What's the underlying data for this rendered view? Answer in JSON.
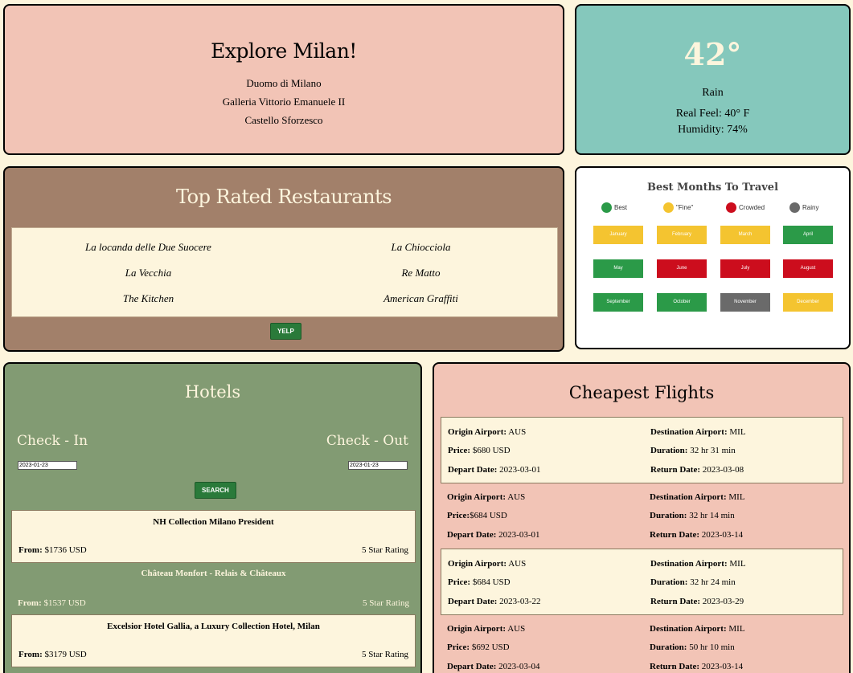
{
  "explore": {
    "title": "Explore Milan!",
    "attractions": [
      "Duomo di Milano",
      "Galleria Vittorio Emanuele II",
      "Castello Sforzesco"
    ]
  },
  "weather": {
    "temperature": "42°",
    "condition": "Rain",
    "real_feel": "Real Feel: 40° F",
    "humidity": "Humidity: 74%"
  },
  "restaurants": {
    "title": "Top Rated Restaurants",
    "items": [
      "La locanda delle Due Suocere",
      "La Chiocciola",
      "La Vecchia",
      "Re Matto",
      "The Kitchen",
      "American Graffiti"
    ],
    "yelp_label": "YELP"
  },
  "months": {
    "title": "Best Months To Travel",
    "legend": [
      {
        "label": "Best",
        "color": "#2b9a48"
      },
      {
        "label": "\"Fine\"",
        "color": "#f4c430"
      },
      {
        "label": "Crowded",
        "color": "#cc0d1d"
      },
      {
        "label": "Rainy",
        "color": "#6a6a6a"
      }
    ],
    "items": [
      {
        "label": "January",
        "color": "#f4c430"
      },
      {
        "label": "February",
        "color": "#f4c430"
      },
      {
        "label": "March",
        "color": "#f4c430"
      },
      {
        "label": "April",
        "color": "#2b9a48"
      },
      {
        "label": "May",
        "color": "#2b9a48"
      },
      {
        "label": "June",
        "color": "#cc0d1d"
      },
      {
        "label": "July",
        "color": "#cc0d1d"
      },
      {
        "label": "August",
        "color": "#cc0d1d"
      },
      {
        "label": "September",
        "color": "#2b9a48"
      },
      {
        "label": "October",
        "color": "#2b9a48"
      },
      {
        "label": "November",
        "color": "#6a6a6a"
      },
      {
        "label": "December",
        "color": "#f4c430"
      }
    ]
  },
  "hotels": {
    "title": "Hotels",
    "check_in_label": "Check - In",
    "check_out_label": "Check - Out",
    "check_in_value": "2023-01-23",
    "check_out_value": "2023-01-23",
    "search_label": "SEARCH",
    "from_label": "From:",
    "items": [
      {
        "name": "NH Collection Milano President",
        "price": "$1736 USD",
        "rating": "5 Star Rating"
      },
      {
        "name": "Château Monfort - Relais & Châteaux",
        "price": "$1537 USD",
        "rating": "5 Star Rating"
      },
      {
        "name": "Excelsior Hotel Gallia, a Luxury Collection Hotel, Milan",
        "price": "$3179 USD",
        "rating": "5 Star Rating"
      }
    ]
  },
  "flights": {
    "title": "Cheapest Flights",
    "labels": {
      "origin": "Origin Airport:",
      "destination": "Destination Airport:",
      "price": "Price:",
      "duration": "Duration:",
      "depart": "Depart Date:",
      "return": "Return Date:"
    },
    "items": [
      {
        "origin": "AUS",
        "destination": "MIL",
        "price": "$680 USD",
        "duration": "32 hr 31 min",
        "depart": "2023-03-01",
        "return": "2023-03-08"
      },
      {
        "origin": "AUS",
        "destination": "MIL",
        "price": "$684 USD",
        "duration": "32 hr 14 min",
        "depart": "2023-03-01",
        "return": "2023-03-14"
      },
      {
        "origin": "AUS",
        "destination": "MIL",
        "price": "$684 USD",
        "duration": "32 hr 24 min",
        "depart": "2023-03-22",
        "return": "2023-03-29"
      },
      {
        "origin": "AUS",
        "destination": "MIL",
        "price": "$692 USD",
        "duration": "50 hr 10 min",
        "depart": "2023-03-04",
        "return": "2023-03-14"
      }
    ]
  }
}
